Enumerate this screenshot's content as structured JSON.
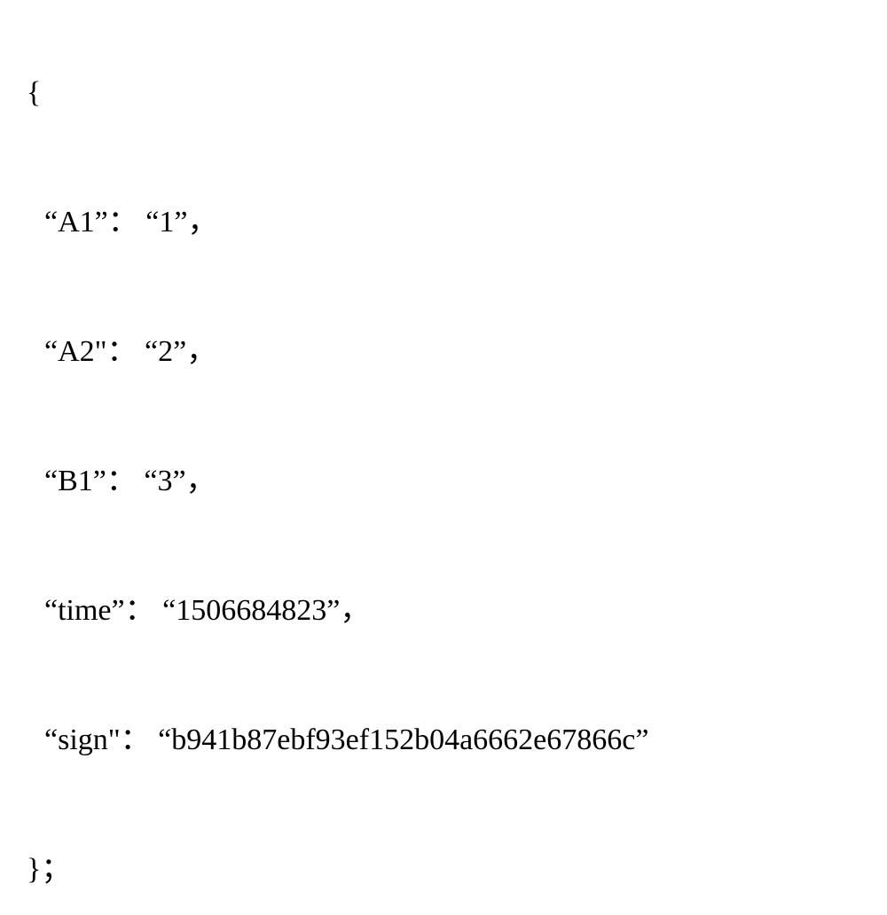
{
  "code": {
    "open_brace": "{",
    "lines": [
      {
        "key": "“A1”",
        "sep": "：",
        "value": "“1”",
        "comma": "，"
      },
      {
        "key": "“A2\"",
        "sep": "：",
        "value": "“2”",
        "comma": "，"
      },
      {
        "key": "“B1”",
        "sep": "：",
        "value": "“3”",
        "comma": "，"
      },
      {
        "key": "“time”",
        "sep": "：",
        "value": "“1506684823”",
        "comma": "，"
      },
      {
        "key": "“sign\"",
        "sep": "：",
        "value": "“b941b87ebf93ef152b04a6662e67866c”",
        "comma": ""
      }
    ],
    "close_brace": "}；"
  }
}
